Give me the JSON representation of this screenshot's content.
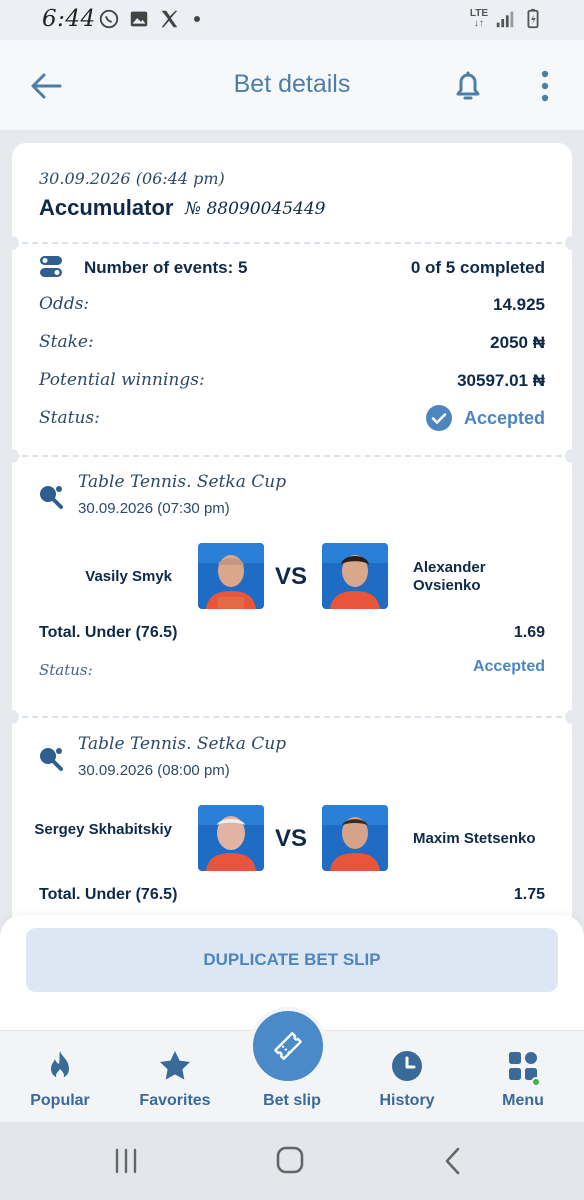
{
  "status_bar": {
    "time": "6:44",
    "network": "LTE"
  },
  "header": {
    "title": "Bet details"
  },
  "bet": {
    "datetime": "30.09.2026 (06:44 pm)",
    "type": "Accumulator",
    "number": "№ 88090045449",
    "events_label": "Number of events: 5",
    "progress": "0 of 5 completed",
    "odds_label": "Odds:",
    "odds_value": "14.925",
    "stake_label": "Stake:",
    "stake_value": "2050 ₦",
    "winnings_label": "Potential winnings:",
    "winnings_value": "30597.01 ₦",
    "status_label": "Status:",
    "status_value": "Accepted"
  },
  "events": [
    {
      "league": "Table Tennis. Setka Cup",
      "datetime": "30.09.2026 (07:30 pm)",
      "player1": "Vasily Smyk",
      "player2": "Alexander Ovsienko",
      "vs": "VS",
      "market": "Total. Under (76.5)",
      "odds": "1.69",
      "status_label": "Status:",
      "status_value": "Accepted"
    },
    {
      "league": "Table Tennis. Setka Cup",
      "datetime": "30.09.2026 (08:00 pm)",
      "player1": "Sergey Skhabitskiy",
      "player2": "Maxim Stetsenko",
      "vs": "VS",
      "market": "Total. Under (76.5)",
      "odds": "1.75"
    }
  ],
  "actions": {
    "duplicate_label": "DUPLICATE BET SLIP"
  },
  "nav": {
    "items": [
      {
        "label": "Popular",
        "icon": "flame-icon"
      },
      {
        "label": "Favorites",
        "icon": "star-icon"
      },
      {
        "label": "Bet slip",
        "icon": "ticket-icon"
      },
      {
        "label": "History",
        "icon": "clock-icon"
      },
      {
        "label": "Menu",
        "icon": "grid-icon"
      }
    ]
  },
  "colors": {
    "accent": "#4d86bf",
    "text_dark": "#0f2a48",
    "nav_text": "#3a6a99"
  }
}
